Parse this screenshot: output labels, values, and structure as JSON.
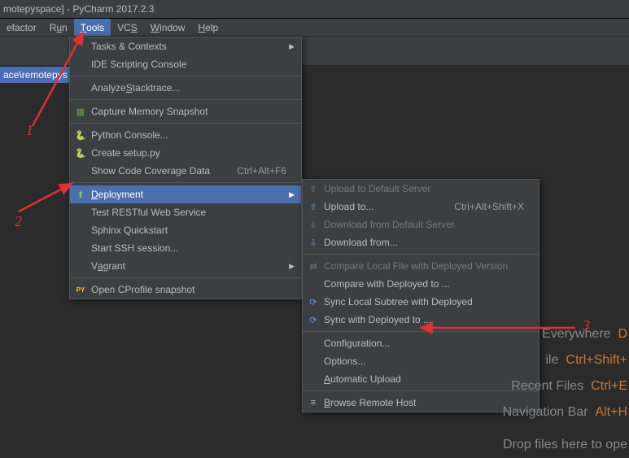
{
  "titlebar": {
    "text": "motepyspace] - PyCharm 2017.2.3"
  },
  "menubar": {
    "items": [
      {
        "label": "efactor"
      },
      {
        "label": "Run",
        "underline": "u"
      },
      {
        "label": "Tools"
      },
      {
        "label": "VCS"
      },
      {
        "label": "Window"
      },
      {
        "label": "Help"
      }
    ]
  },
  "breadcrumb": {
    "seg1": "ace",
    "seg2": "remotepys"
  },
  "tools_menu": {
    "tasks": "Tasks & Contexts",
    "ide_scripting": "IDE Scripting Console",
    "analyze_stack": "Analyze Stacktrace...",
    "capture_mem": "Capture Memory Snapshot",
    "python_console": "Python Console...",
    "create_setup": "Create setup.py",
    "show_coverage": "Show Code Coverage Data",
    "show_coverage_shortcut": "Ctrl+Alt+F6",
    "deployment": "Deployment",
    "test_restful": "Test RESTful Web Service",
    "sphinx": "Sphinx Quickstart",
    "start_ssh": "Start SSH session...",
    "vagrant": "Vagrant",
    "open_cprofile": "Open CProfile snapshot"
  },
  "deploy_menu": {
    "upload_default": "Upload to Default Server",
    "upload_to": "Upload to...",
    "upload_to_shortcut": "Ctrl+Alt+Shift+X",
    "download_default": "Download from Default Server",
    "download_from": "Download from...",
    "compare_local": "Compare Local File with Deployed Version",
    "compare_with": "Compare with Deployed to ...",
    "sync_local": "Sync Local Subtree with Deployed",
    "sync_with": "Sync with Deployed to ...",
    "configuration": "Configuration...",
    "options": "Options...",
    "auto_upload": "Automatic Upload",
    "browse_remote": "Browse Remote Host"
  },
  "bg_hints": {
    "everywhere": "Everywhere",
    "everywhere_key": "D",
    "file_label": "ile",
    "file_key": "Ctrl+Shift+",
    "recent": "Recent Files",
    "recent_key": "Ctrl+E",
    "nav": "Navigation Bar",
    "nav_key": "Alt+H",
    "drop": "Drop files here to ope"
  },
  "annotations": {
    "one": "1",
    "two": "2",
    "three": "3"
  }
}
